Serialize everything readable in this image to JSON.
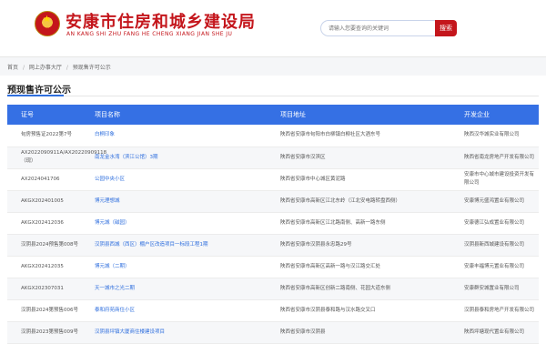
{
  "header": {
    "title": "安康市住房和城乡建设局",
    "subtitle": "AN KANG SHI ZHU FANG HE CHENG XIANG JIAN SHE JU",
    "search_placeholder": "请输入您要查询的关键词",
    "search_button": "搜索"
  },
  "breadcrumb": [
    "首页",
    "网上办事大厅",
    "预现售许可公示"
  ],
  "page": {
    "title": "预现售许可公示"
  },
  "table": {
    "headers": [
      "证号",
      "项目名称",
      "项目地址",
      "开发企业"
    ],
    "rows": [
      [
        "旬房预售证2022第7号",
        "白桐印象",
        "陕西省安康市旬阳市白柳镇白柳社区大酒东号",
        "陕西汉华城实业有限公司"
      ],
      [
        "AX2022090911A/AX20220909118（现）",
        "南龙金水湾（滨江公馆）3期",
        "陕西省安康市汉滨区",
        "陕西省南龙房地产开发有限公司"
      ],
      [
        "AX2024041706",
        "公园中央小区",
        "陕西省安康市中心城区黄泥路",
        "安康市中心城市建设投资开发有限公司"
      ],
      [
        "AKGX202401005",
        "博元理想城",
        "陕西省安康市高新区江北东岭（江北安电路转盘西侧）",
        "安康博元盛鸿置业有限公司"
      ],
      [
        "AKGX202412036",
        "博元城（磁园）",
        "陕西省安康市高新区江北路南侧、高新一路东侧",
        "安康德江弘成置业有限公司"
      ],
      [
        "汉阴县2024预售第008号",
        "汉阴县西城（西区）棚户区改造项目一标段工程1期",
        "陕西省安康市汉阴县永忠路29号",
        "汉阴县新西城建设有限公司"
      ],
      [
        "AKGX202412035",
        "博元城（二期）",
        "陕西省安康市高新区高新一路与汉江路交汇处",
        "安康丰福博元置业有限公司"
      ],
      [
        "AKGX202307031",
        "天一城市之光二期",
        "陕西省安康市高新区创新二路南侧、花园大道东侧",
        "安康群安城置业有限公司"
      ],
      [
        "汉阴县2024第预售006号",
        "泰和府苑商住小区",
        "陕西省安康市汉阴县泰和路与汉水路交叉口",
        "汉阴县泰和房地产开发有限公司"
      ],
      [
        "汉阴县2023第预售009号",
        "汉阴县坪镇大厦商住楼建设项目",
        "陕西省安康市汉阴县",
        "陕西坪塘现代置业有限公司"
      ]
    ]
  },
  "colors": {
    "brand_red": "#c4161c",
    "accent_blue": "#3570e4",
    "link_blue": "#2f6fde"
  }
}
